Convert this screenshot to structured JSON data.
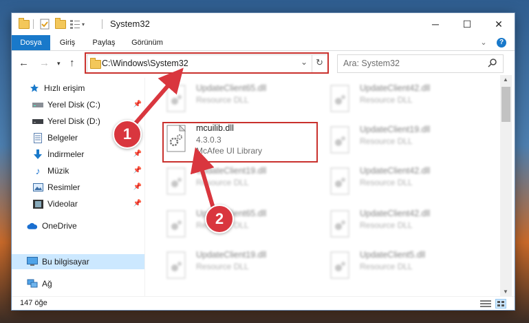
{
  "window": {
    "title": "System32",
    "controls": {
      "minimize": "─",
      "maximize": "☐",
      "close": "✕"
    }
  },
  "ribbon": {
    "tabs": [
      {
        "label": "Dosya",
        "active": true
      },
      {
        "label": "Giriş"
      },
      {
        "label": "Paylaş"
      },
      {
        "label": "Görünüm"
      }
    ],
    "help_icon": "help-icon"
  },
  "address": {
    "path": "C:\\Windows\\System32",
    "search_placeholder": "Ara: System32"
  },
  "sidebar": {
    "items": [
      {
        "label": "Hızlı erişim",
        "icon": "star-icon"
      },
      {
        "label": "Yerel Disk (C:)",
        "icon": "drive-icon",
        "pinned": true
      },
      {
        "label": "Yerel Disk (D:)",
        "icon": "drive-icon"
      },
      {
        "label": "Belgeler",
        "icon": "documents-icon",
        "pinned": true
      },
      {
        "label": "İndirmeler",
        "icon": "download-icon",
        "pinned": true
      },
      {
        "label": "Müzik",
        "icon": "music-icon",
        "pinned": true
      },
      {
        "label": "Resimler",
        "icon": "pictures-icon",
        "pinned": true
      },
      {
        "label": "Videolar",
        "icon": "videos-icon",
        "pinned": true
      },
      {
        "label": "OneDrive",
        "icon": "cloud-icon"
      },
      {
        "label": "Bu bilgisayar",
        "icon": "computer-icon",
        "selected": true
      },
      {
        "label": "Ağ",
        "icon": "network-icon"
      }
    ]
  },
  "files": {
    "highlighted": {
      "name": "mcuilib.dll",
      "version": "4.3.0.3",
      "description": "McAfee UI Library"
    },
    "background": [
      {
        "name": "UpdateClient65.dll",
        "type": "Resource DLL"
      },
      {
        "name": "UpdateClient42.dll",
        "type": "Resource DLL"
      },
      {
        "name": "UpdateClient19.dll",
        "type": "Resource DLL"
      },
      {
        "name": "UpdateClient19.dll",
        "type": "Resource DLL"
      },
      {
        "name": "UpdateClient42.dll",
        "type": "Resource DLL"
      },
      {
        "name": "UpdateClient65.dll",
        "type": "Resource DLL"
      },
      {
        "name": "UpdateClient42.dll",
        "type": "Resource DLL"
      },
      {
        "name": "UpdateClient19.dll",
        "type": "Resource DLL"
      },
      {
        "name": "UpdateClient5.dll",
        "type": "Resource DLL"
      }
    ]
  },
  "status": {
    "item_count": "147 öğe"
  },
  "callouts": {
    "step1": "1",
    "step2": "2"
  },
  "colors": {
    "accent": "#1979ca",
    "highlight_box": "#c9302c",
    "badge": "#d9363e",
    "selected_bg": "#cce8ff"
  }
}
